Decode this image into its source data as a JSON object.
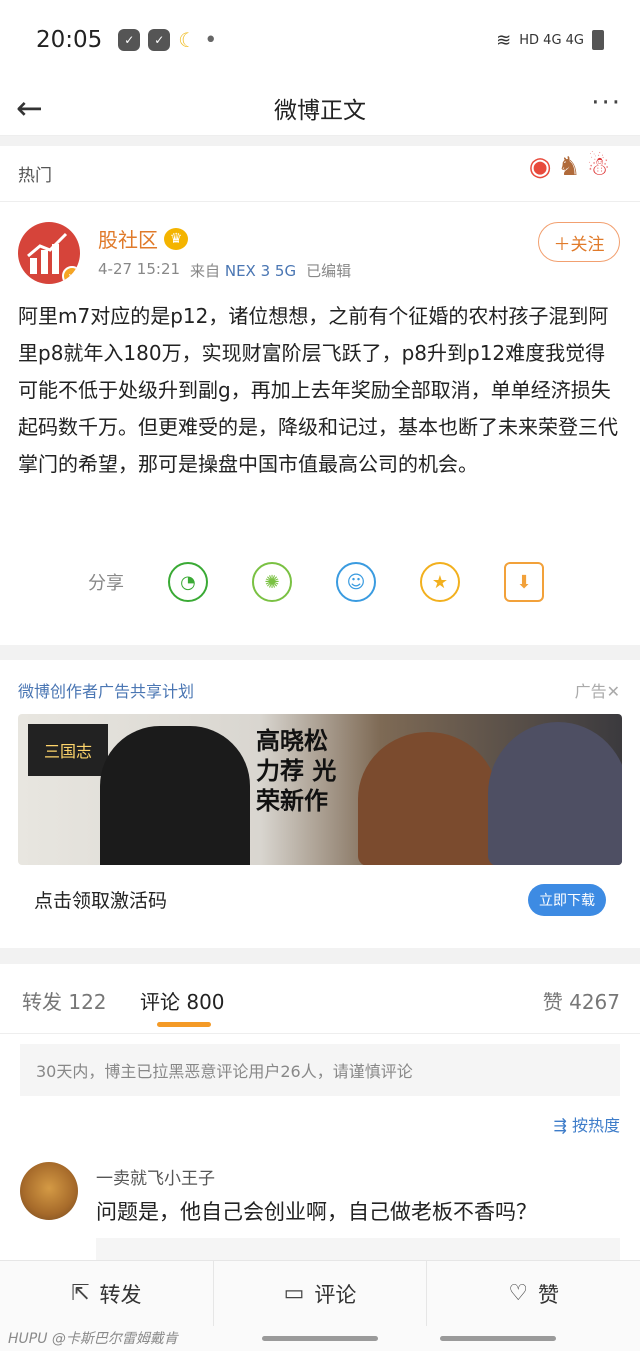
{
  "status": {
    "time": "20:05",
    "network": "HD 4G 4G"
  },
  "nav": {
    "title": "微博正文",
    "back": "←",
    "more": "···"
  },
  "hot": {
    "label": "热门"
  },
  "post": {
    "author": "股社区",
    "date": "4-27 15:21",
    "from_label": "来自",
    "source": "NEX 3 5G",
    "edited": "已编辑",
    "follow_label": "＋关注",
    "text": "阿里m7对应的是p12，诸位想想，之前有个征婚的农村孩子混到阿里p8就年入180万，实现财富阶层飞跃了，p8升到p12难度我觉得可能不低于处级升到副g，再加上去年奖励全部取消，单单经济损失起码数千万。但更难受的是，降级和记过，基本也断了未来荣登三代掌门的希望，那可是操盘中国市值最高公司的机会。",
    "share_label": "分享"
  },
  "ad": {
    "header": "微博创作者广告共享计划",
    "tag": "广告✕",
    "logo_text": "三国志",
    "calligraphy": "高晓松力荐 光荣新作",
    "cta_text": "点击领取激活码",
    "download_label": "立即下载"
  },
  "tabs": {
    "repost": "转发 122",
    "comment": "评论 800",
    "like": "赞 4267"
  },
  "comments": {
    "notice": "30天内，博主已拉黑恶意评论用户26人，请谨慎评论",
    "sort_label": "⇶ 按热度",
    "first": {
      "name": "一卖就飞小王子",
      "text": "问题是，他自己会创业啊，自己做老板不香吗？"
    }
  },
  "bottom": {
    "repost": "转发",
    "comment": "评论",
    "like": "赞"
  },
  "watermark": "HUPU @卡斯巴尔雷姆戴肯",
  "colors": {
    "accent": "#e07a2a",
    "link": "#4a76b3",
    "download": "#3d8be3"
  }
}
